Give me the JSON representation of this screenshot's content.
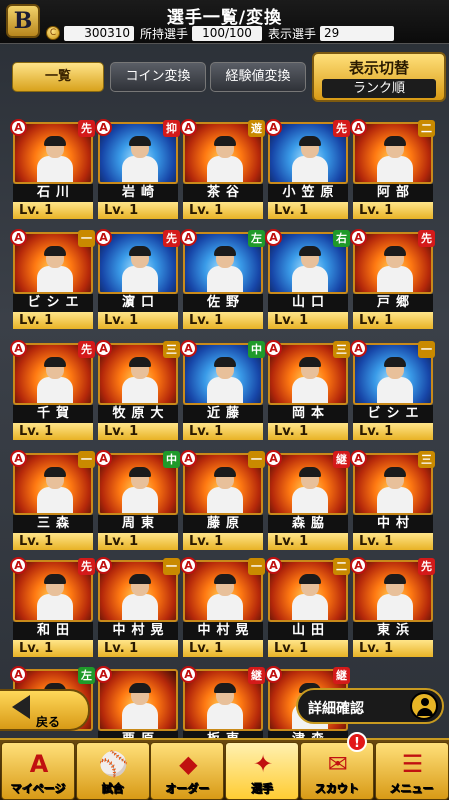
{
  "header": {
    "title": "選手一覧/変換",
    "logo_letter": "B",
    "coin_symbol": "C",
    "coins": "300310",
    "owned_label": "所持選手",
    "owned_value": "100/100",
    "shown_label": "表示選手",
    "shown_value": "29"
  },
  "tabs": [
    {
      "label": "一覧",
      "active": true
    },
    {
      "label": "コイン変換",
      "active": false
    },
    {
      "label": "経験値変換",
      "active": false
    }
  ],
  "display_toggle": {
    "label": "表示切替",
    "value": "ランク順"
  },
  "players": [
    {
      "rank": "A",
      "pos": "先",
      "name": "石川",
      "level": "Lv. 1",
      "theme": "fire"
    },
    {
      "rank": "A",
      "pos": "抑",
      "name": "岩崎",
      "level": "Lv. 1",
      "theme": "blue"
    },
    {
      "rank": "A",
      "pos": "遊",
      "name": "茶谷",
      "level": "Lv. 1",
      "theme": "fire"
    },
    {
      "rank": "A",
      "pos": "先",
      "name": "小笠原",
      "level": "Lv. 1",
      "theme": "blue"
    },
    {
      "rank": "A",
      "pos": "二",
      "name": "阿部",
      "level": "Lv. 1",
      "theme": "fire"
    },
    {
      "rank": "A",
      "pos": "一",
      "name": "ビシエド",
      "level": "Lv. 1",
      "theme": "fire"
    },
    {
      "rank": "A",
      "pos": "先",
      "name": "濵口",
      "level": "Lv. 1",
      "theme": "blue"
    },
    {
      "rank": "A",
      "pos": "左",
      "name": "佐野",
      "level": "Lv. 1",
      "theme": "blue"
    },
    {
      "rank": "A",
      "pos": "右",
      "name": "山口",
      "level": "Lv. 1",
      "theme": "blue"
    },
    {
      "rank": "A",
      "pos": "先",
      "name": "戸郷",
      "level": "Lv. 1",
      "theme": "fire"
    },
    {
      "rank": "A",
      "pos": "先",
      "name": "千賀",
      "level": "Lv. 1",
      "theme": "fire"
    },
    {
      "rank": "A",
      "pos": "三",
      "name": "牧原大",
      "level": "Lv. 1",
      "theme": "fire"
    },
    {
      "rank": "A",
      "pos": "中",
      "name": "近藤",
      "level": "Lv. 1",
      "theme": "blue"
    },
    {
      "rank": "A",
      "pos": "三",
      "name": "岡本",
      "level": "Lv. 1",
      "theme": "fire"
    },
    {
      "rank": "A",
      "pos": "一",
      "name": "ビシエド",
      "level": "Lv. 1",
      "theme": "blue"
    },
    {
      "rank": "A",
      "pos": "一",
      "name": "三森",
      "level": "Lv. 1",
      "theme": "fire"
    },
    {
      "rank": "A",
      "pos": "中",
      "name": "周東",
      "level": "Lv. 1",
      "theme": "fire"
    },
    {
      "rank": "A",
      "pos": "一",
      "name": "藤原",
      "level": "Lv. 1",
      "theme": "fire"
    },
    {
      "rank": "A",
      "pos": "継",
      "name": "森脇",
      "level": "Lv. 1",
      "theme": "fire"
    },
    {
      "rank": "A",
      "pos": "三",
      "name": "中村",
      "level": "Lv. 1",
      "theme": "fire"
    },
    {
      "rank": "A",
      "pos": "先",
      "name": "和田",
      "level": "Lv. 1",
      "theme": "fire"
    },
    {
      "rank": "A",
      "pos": "一",
      "name": "中村晃",
      "level": "Lv. 1",
      "theme": "fire"
    },
    {
      "rank": "A",
      "pos": "一",
      "name": "中村晃",
      "level": "Lv. 1",
      "theme": "fire"
    },
    {
      "rank": "A",
      "pos": "二",
      "name": "山田",
      "level": "Lv. 1",
      "theme": "fire"
    },
    {
      "rank": "A",
      "pos": "先",
      "name": "東浜",
      "level": "Lv. 1",
      "theme": "fire"
    },
    {
      "rank": "A",
      "pos": "左",
      "name": "",
      "level": "",
      "theme": "fire"
    },
    {
      "rank": "A",
      "pos": "",
      "name": "栗原",
      "level": "",
      "theme": "fire"
    },
    {
      "rank": "A",
      "pos": "継",
      "name": "板東",
      "level": "",
      "theme": "fire"
    },
    {
      "rank": "A",
      "pos": "継",
      "name": "津森",
      "level": "",
      "theme": "fire"
    }
  ],
  "position_colors": {
    "先": "#d41a1a",
    "抑": "#d41a1a",
    "継": "#d41a1a",
    "遊": "#c98a00",
    "二": "#c98a00",
    "三": "#c98a00",
    "一": "#c98a00",
    "左": "#1f9a2a",
    "右": "#1f9a2a",
    "中": "#1f9a2a"
  },
  "back_button": {
    "label": "戻る"
  },
  "detail_button": {
    "label": "詳細確認"
  },
  "nav": [
    {
      "label": "マイページ",
      "icon": "A"
    },
    {
      "label": "試合",
      "icon": "⚾"
    },
    {
      "label": "オーダー",
      "icon": "◆"
    },
    {
      "label": "選手",
      "icon": "✦",
      "active": true
    },
    {
      "label": "スカウト",
      "icon": "✉"
    },
    {
      "label": "メニュー",
      "icon": "☰"
    }
  ],
  "notice_badge": "!"
}
